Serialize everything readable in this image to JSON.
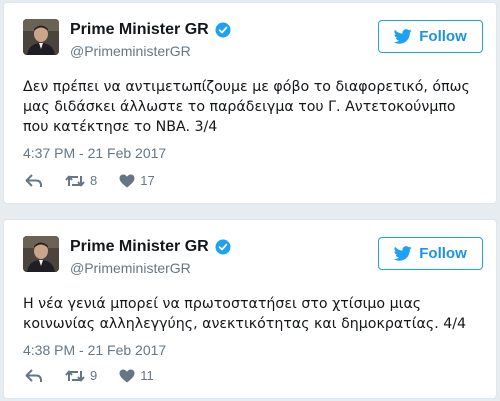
{
  "tweets": [
    {
      "display_name": "Prime Minister GR",
      "handle": "@PrimeministerGR",
      "follow_label": "Follow",
      "text": "Δεν πρέπει να αντιμετωπίζουμε με φόβο το διαφορετικό, όπως μας διδάσκει άλλωστε το παράδειγμα του Γ. Αντετοκούνμπο που κατέκτησε το NBA. 3/4",
      "timestamp": "4:37 PM - 21 Feb 2017",
      "retweets": "8",
      "likes": "17",
      "icons": [
        "reply-icon",
        "retweet-icon",
        "like-icon",
        "verified-badge-icon",
        "bird-icon"
      ]
    },
    {
      "display_name": "Prime Minister GR",
      "handle": "@PrimeministerGR",
      "follow_label": "Follow",
      "text": "Η νέα γενιά μπορεί να πρωτοστατήσει στο χτίσιμο μιας κοινωνίας αλληλεγγύης, ανεκτικότητας και δημοκρατίας. 4/4",
      "timestamp": "4:38 PM - 21 Feb 2017",
      "retweets": "9",
      "likes": "11",
      "icons": [
        "reply-icon",
        "retweet-icon",
        "like-icon",
        "verified-badge-icon",
        "bird-icon"
      ]
    }
  ],
  "colors": {
    "accent": "#1da1f2",
    "name": "#14171a",
    "secondary": "#657786",
    "background": "#e6ecf0"
  }
}
